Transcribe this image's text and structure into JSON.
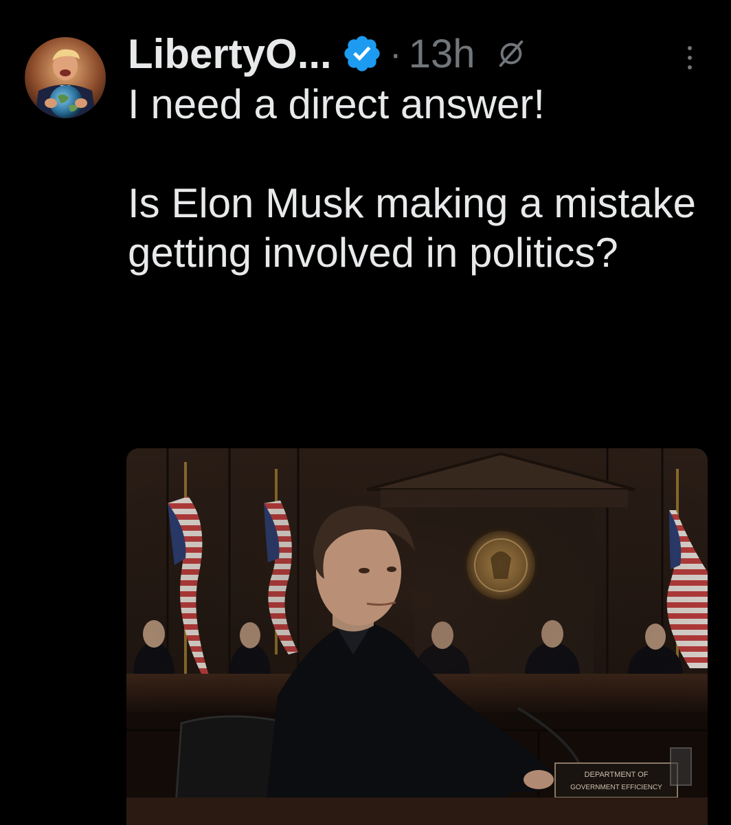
{
  "post": {
    "display_name": "LibertyO...",
    "separator": "·",
    "time": "13h",
    "text": "I need a direct answer!\n\nIs Elon Musk making a mistake getting involved in politics?"
  },
  "media": {
    "placard_line1": "DEPARTMENT OF",
    "placard_line2": "GOVERNMENT EFFICIENCY"
  },
  "icons": {
    "verified": "verified-badge-icon",
    "grok": "grok-icon",
    "more": "more-vertical-icon"
  },
  "colors": {
    "background": "#000000",
    "text_primary": "#e7e9ea",
    "text_secondary": "#71767b",
    "verified_blue": "#1d9bf0"
  }
}
